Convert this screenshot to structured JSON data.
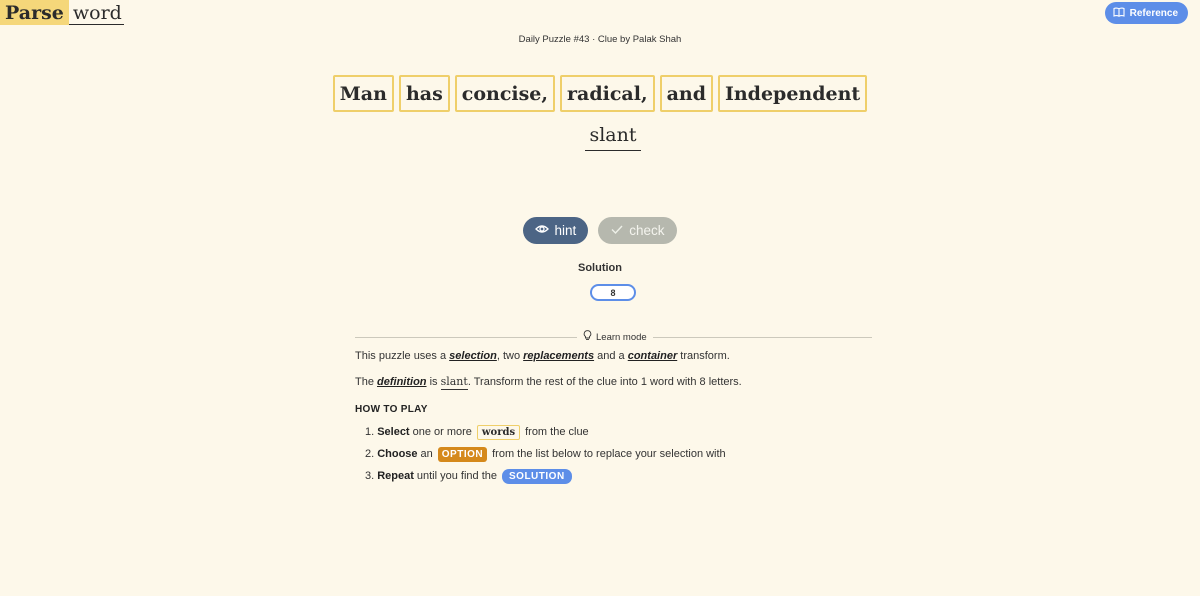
{
  "logo": {
    "part1": "Parse",
    "part2": "word"
  },
  "reference_button": {
    "label": "Reference",
    "icon": "book-icon"
  },
  "subtitle": "Daily Puzzle #43 · Clue by Palak Shah",
  "clue_words": [
    "Man",
    "has",
    "concise,",
    "radical,",
    "and",
    "Independent"
  ],
  "definition": "slant",
  "actions": {
    "hint": {
      "label": "hint",
      "icon": "eye-icon"
    },
    "check": {
      "label": "check",
      "icon": "check-icon"
    }
  },
  "solution": {
    "label": "Solution",
    "length": "8"
  },
  "learn_mode": {
    "label": "Learn mode",
    "icon": "lightbulb-icon"
  },
  "explanation": {
    "p1_a": "This puzzle uses a ",
    "p1_t1": "selection",
    "p1_b": ", two ",
    "p1_t2": "replacements",
    "p1_c": " and a ",
    "p1_t3": "container",
    "p1_d": " transform.",
    "p2_a": "The ",
    "p2_t1": "definition",
    "p2_b": " is ",
    "p2_def": "slant",
    "p2_c": ". Transform the rest of the clue into 1 word with 8 letters."
  },
  "how_to_play": {
    "heading": "HOW TO PLAY",
    "step1": {
      "num": "1.",
      "bold": "Select",
      "a": " one or more ",
      "chip": "words",
      "b": " from the clue"
    },
    "step2": {
      "num": "2.",
      "bold": "Choose",
      "a": " an ",
      "chip": "OPTION",
      "b": " from the list below to replace your selection with"
    },
    "step3": {
      "num": "3.",
      "bold": "Repeat",
      "a": " until you find the ",
      "chip": "SOLUTION"
    }
  },
  "colors": {
    "background": "#fdf8ea",
    "highlight": "#f5d77a",
    "word_border": "#efcf6a",
    "accent_blue": "#5d8ee8",
    "hint_button": "#4c6585",
    "check_button": "#b6b8ae",
    "option_orange": "#d5891b"
  }
}
